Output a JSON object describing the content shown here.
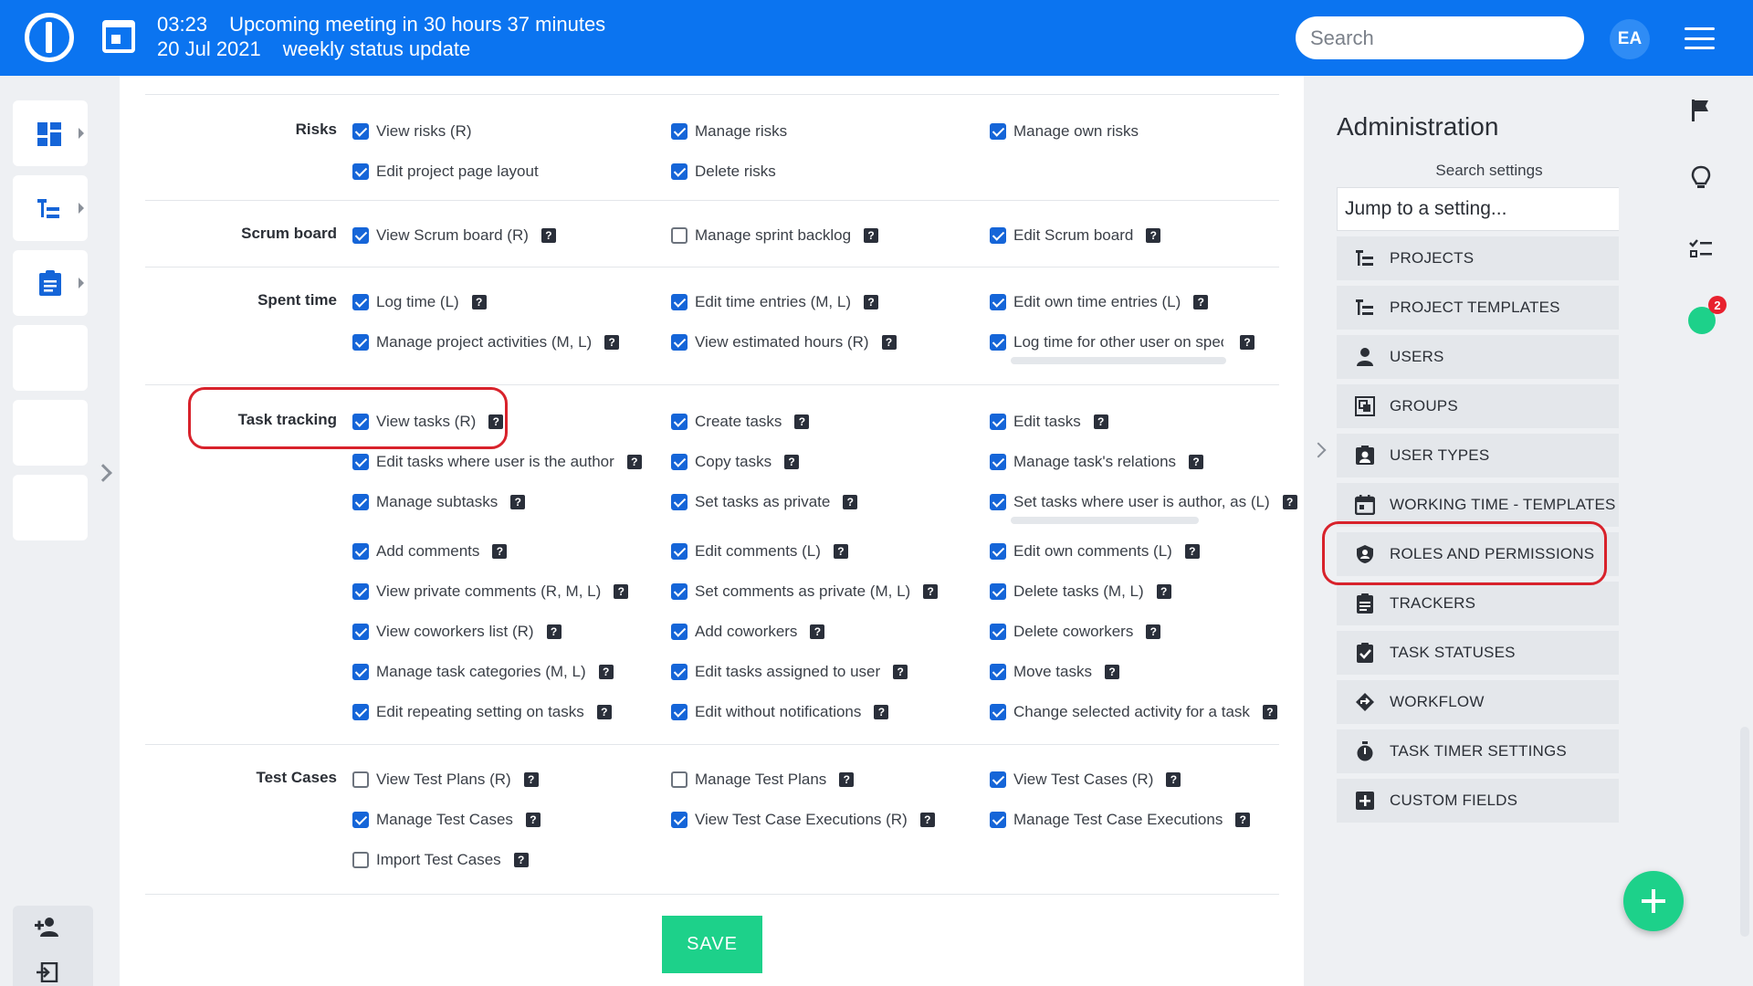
{
  "header": {
    "time": "03:23",
    "meeting_text": "Upcoming meeting in 30 hours 37 minutes",
    "date": "20 Jul 2021",
    "meeting_title": "weekly status update",
    "search_placeholder": "Search",
    "avatar_initials": "EA"
  },
  "sections": {
    "risks": {
      "label": "Risks",
      "items": [
        {
          "label": "View risks (R)",
          "checked": true
        },
        {
          "label": "Manage risks",
          "checked": true
        },
        {
          "label": "Manage own risks",
          "checked": true
        },
        {
          "label": "Edit project page layout",
          "checked": true
        },
        {
          "label": "Delete risks",
          "checked": true
        }
      ]
    },
    "scrum": {
      "label": "Scrum board",
      "items": [
        {
          "label": "View Scrum board (R)",
          "checked": true
        },
        {
          "label": "Manage sprint backlog",
          "checked": false
        },
        {
          "label": "Edit Scrum board",
          "checked": true
        }
      ]
    },
    "spent": {
      "label": "Spent time",
      "items": [
        {
          "label": "Log time (L)",
          "checked": true
        },
        {
          "label": "Edit time entries (M, L)",
          "checked": true
        },
        {
          "label": "Edit own time entries (L)",
          "checked": true
        },
        {
          "label": "Manage project activities (M, L)",
          "checked": true
        },
        {
          "label": "View estimated hours (R)",
          "checked": true
        },
        {
          "label": "Log time for other user on specific pı",
          "checked": true
        }
      ]
    },
    "task": {
      "label": "Task tracking",
      "items": [
        {
          "label": "View tasks (R)",
          "checked": true
        },
        {
          "label": "Create tasks",
          "checked": true
        },
        {
          "label": "Edit tasks",
          "checked": true
        },
        {
          "label": "Edit tasks where user is the author",
          "checked": true
        },
        {
          "label": "Copy tasks",
          "checked": true
        },
        {
          "label": "Manage task's relations",
          "checked": true
        },
        {
          "label": "Manage subtasks",
          "checked": true
        },
        {
          "label": "Set tasks as private",
          "checked": true
        },
        {
          "label": "Set tasks where user is author, as (L)",
          "checked": true
        },
        {
          "label": "Add comments",
          "checked": true
        },
        {
          "label": "Edit comments (L)",
          "checked": true
        },
        {
          "label": "Edit own comments (L)",
          "checked": true
        },
        {
          "label": "View private comments (R, M, L)",
          "checked": true
        },
        {
          "label": "Set comments as private (M, L)",
          "checked": true
        },
        {
          "label": "Delete tasks (M, L)",
          "checked": true
        },
        {
          "label": "View coworkers list (R)",
          "checked": true
        },
        {
          "label": "Add coworkers",
          "checked": true
        },
        {
          "label": "Delete coworkers",
          "checked": true
        },
        {
          "label": "Manage task categories (M, L)",
          "checked": true
        },
        {
          "label": "Edit tasks assigned to user",
          "checked": true
        },
        {
          "label": "Move tasks",
          "checked": true
        },
        {
          "label": "Edit repeating setting on tasks",
          "checked": true
        },
        {
          "label": "Edit without notifications",
          "checked": true
        },
        {
          "label": "Change selected activity for a task",
          "checked": true
        }
      ]
    },
    "test": {
      "label": "Test Cases",
      "items": [
        {
          "label": "View Test Plans (R)",
          "checked": false
        },
        {
          "label": "Manage Test Plans",
          "checked": false
        },
        {
          "label": "View Test Cases (R)",
          "checked": true
        },
        {
          "label": "Manage Test Cases",
          "checked": true
        },
        {
          "label": "View Test Case Executions (R)",
          "checked": true
        },
        {
          "label": "Manage Test Case Executions",
          "checked": true
        },
        {
          "label": "Import Test Cases",
          "checked": false
        }
      ]
    }
  },
  "help_glyph": "?",
  "save_label": "SAVE",
  "admin": {
    "title": "Administration",
    "search_label": "Search settings",
    "jump_placeholder": "Jump to a setting...",
    "items": [
      {
        "label": "PROJECTS",
        "icon": "projects-icon"
      },
      {
        "label": "PROJECT TEMPLATES",
        "icon": "project-templates-icon"
      },
      {
        "label": "USERS",
        "icon": "user-icon"
      },
      {
        "label": "GROUPS",
        "icon": "groups-icon"
      },
      {
        "label": "USER TYPES",
        "icon": "user-types-icon"
      },
      {
        "label": "WORKING TIME - TEMPLATES",
        "icon": "calendar-icon"
      },
      {
        "label": "ROLES AND PERMISSIONS",
        "icon": "shield-icon"
      },
      {
        "label": "TRACKERS",
        "icon": "clipboard-icon"
      },
      {
        "label": "TASK STATUSES",
        "icon": "clipboard-check-icon"
      },
      {
        "label": "WORKFLOW",
        "icon": "workflow-icon"
      },
      {
        "label": "TASK TIMER SETTINGS",
        "icon": "stopwatch-icon"
      },
      {
        "label": "CUSTOM FIELDS",
        "icon": "plus-box-icon"
      }
    ]
  },
  "timer_badge": "2",
  "colors": {
    "header_bg": "#0b74f0",
    "checkbox_checked": "#1565d8",
    "accent_green": "#1dd18a",
    "highlight_red": "#d8222b"
  }
}
